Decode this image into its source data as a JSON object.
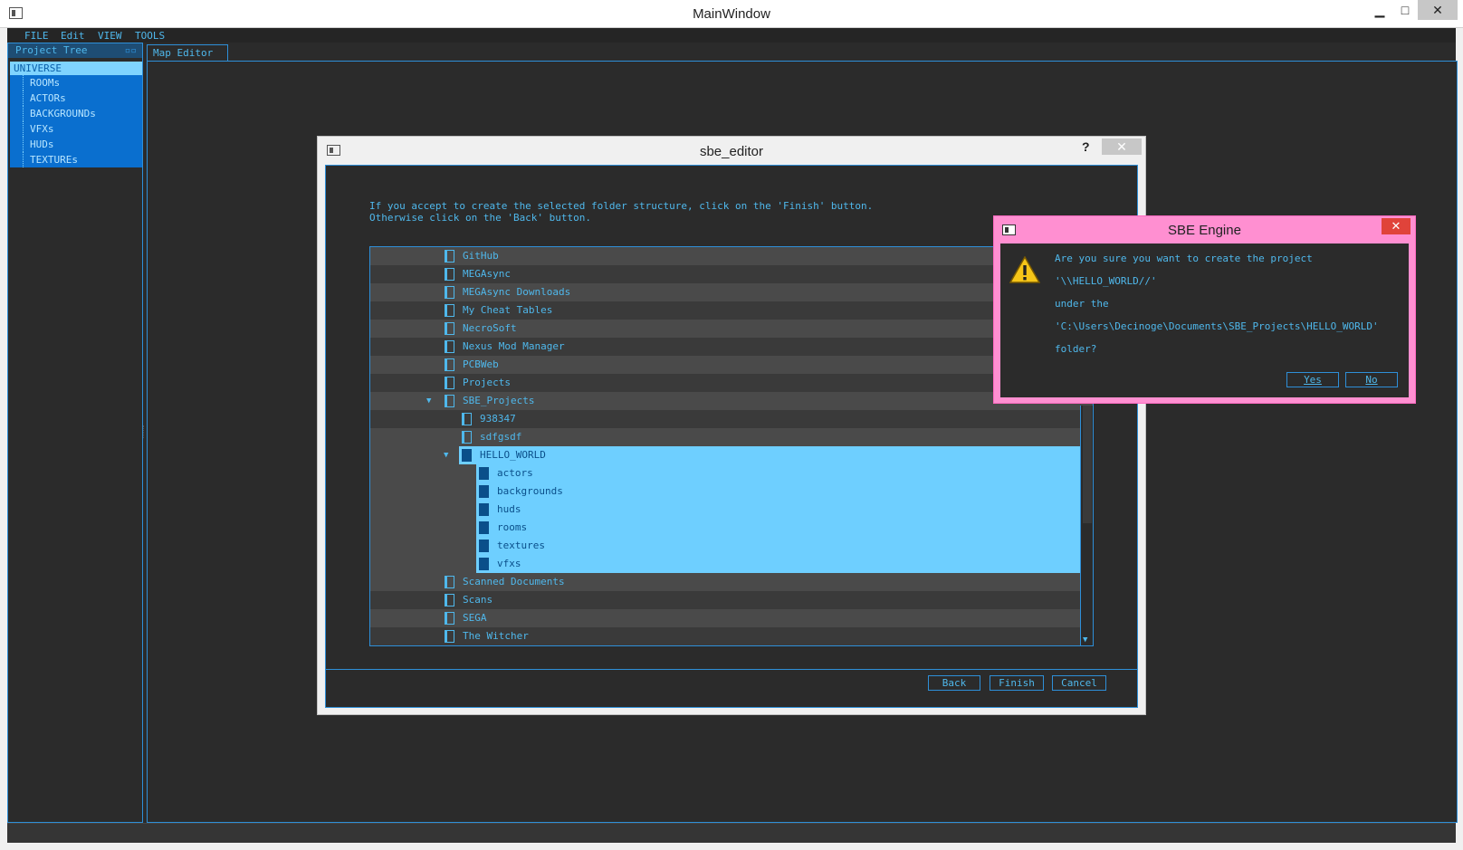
{
  "main_window": {
    "title": "MainWindow",
    "controls": {
      "minimize": "▁",
      "maximize": "□",
      "close": "✕"
    }
  },
  "menubar": {
    "items": [
      "FILE",
      "Edit",
      "VIEW",
      "TOOLS"
    ]
  },
  "project_tree": {
    "header": "Project Tree",
    "root": "UNIVERSE",
    "children": [
      "ROOMs",
      "ACTORs",
      "BACKGROUNDs",
      "VFXs",
      "HUDs",
      "TEXTUREs"
    ]
  },
  "editor": {
    "tab": "Map Editor"
  },
  "wizard": {
    "title": "sbe_editor",
    "help": "?",
    "close": "✕",
    "instructions": "If you accept to create the selected folder structure, click on the 'Finish' button.\nOtherwise click on the 'Back' button.",
    "folders": [
      {
        "name": "GitHub",
        "level": 0,
        "expanded": false,
        "selected": false
      },
      {
        "name": "MEGAsync",
        "level": 0,
        "expanded": false,
        "selected": false
      },
      {
        "name": "MEGAsync Downloads",
        "level": 0,
        "expanded": false,
        "selected": false
      },
      {
        "name": "My Cheat Tables",
        "level": 0,
        "expanded": false,
        "selected": false
      },
      {
        "name": "NecroSoft",
        "level": 0,
        "expanded": false,
        "selected": false
      },
      {
        "name": "Nexus Mod Manager",
        "level": 0,
        "expanded": false,
        "selected": false
      },
      {
        "name": "PCBWeb",
        "level": 0,
        "expanded": false,
        "selected": false
      },
      {
        "name": "Projects",
        "level": 0,
        "expanded": false,
        "selected": false
      },
      {
        "name": "SBE_Projects",
        "level": 0,
        "expanded": true,
        "selected": false
      },
      {
        "name": "938347",
        "level": 1,
        "expanded": false,
        "selected": false
      },
      {
        "name": "sdfgsdf",
        "level": 1,
        "expanded": false,
        "selected": false
      },
      {
        "name": "HELLO_WORLD",
        "level": 1,
        "expanded": true,
        "selected": true
      },
      {
        "name": "actors",
        "level": 2,
        "expanded": false,
        "selected": true
      },
      {
        "name": "backgrounds",
        "level": 2,
        "expanded": false,
        "selected": true
      },
      {
        "name": "huds",
        "level": 2,
        "expanded": false,
        "selected": true
      },
      {
        "name": "rooms",
        "level": 2,
        "expanded": false,
        "selected": true
      },
      {
        "name": "textures",
        "level": 2,
        "expanded": false,
        "selected": true
      },
      {
        "name": "vfxs",
        "level": 2,
        "expanded": false,
        "selected": true
      },
      {
        "name": "Scanned Documents",
        "level": 0,
        "expanded": false,
        "selected": false
      },
      {
        "name": "Scans",
        "level": 0,
        "expanded": false,
        "selected": false
      },
      {
        "name": "SEGA",
        "level": 0,
        "expanded": false,
        "selected": false
      },
      {
        "name": "The Witcher",
        "level": 0,
        "expanded": false,
        "selected": false
      }
    ],
    "buttons": {
      "back": "Back",
      "finish": "Finish",
      "cancel": "Cancel"
    }
  },
  "message_box": {
    "title": "SBE Engine",
    "close": "✕",
    "lines": [
      "Are you sure you want to create the project",
      "'\\\\HELLO_WORLD//'",
      "under the",
      "'C:\\Users\\Decinoge\\Documents\\SBE_Projects\\HELLO_WORLD'",
      "folder?"
    ],
    "buttons": {
      "yes": "Yes",
      "no": "No"
    },
    "icon": "warning-icon"
  },
  "colors": {
    "accent": "#4fb8ec",
    "border": "#2e8fd8",
    "background": "#2b2b2b",
    "selection": "#6ecfff",
    "tree_selection": "#0a6fcf",
    "dialog_frame": "#ff8fd1"
  }
}
